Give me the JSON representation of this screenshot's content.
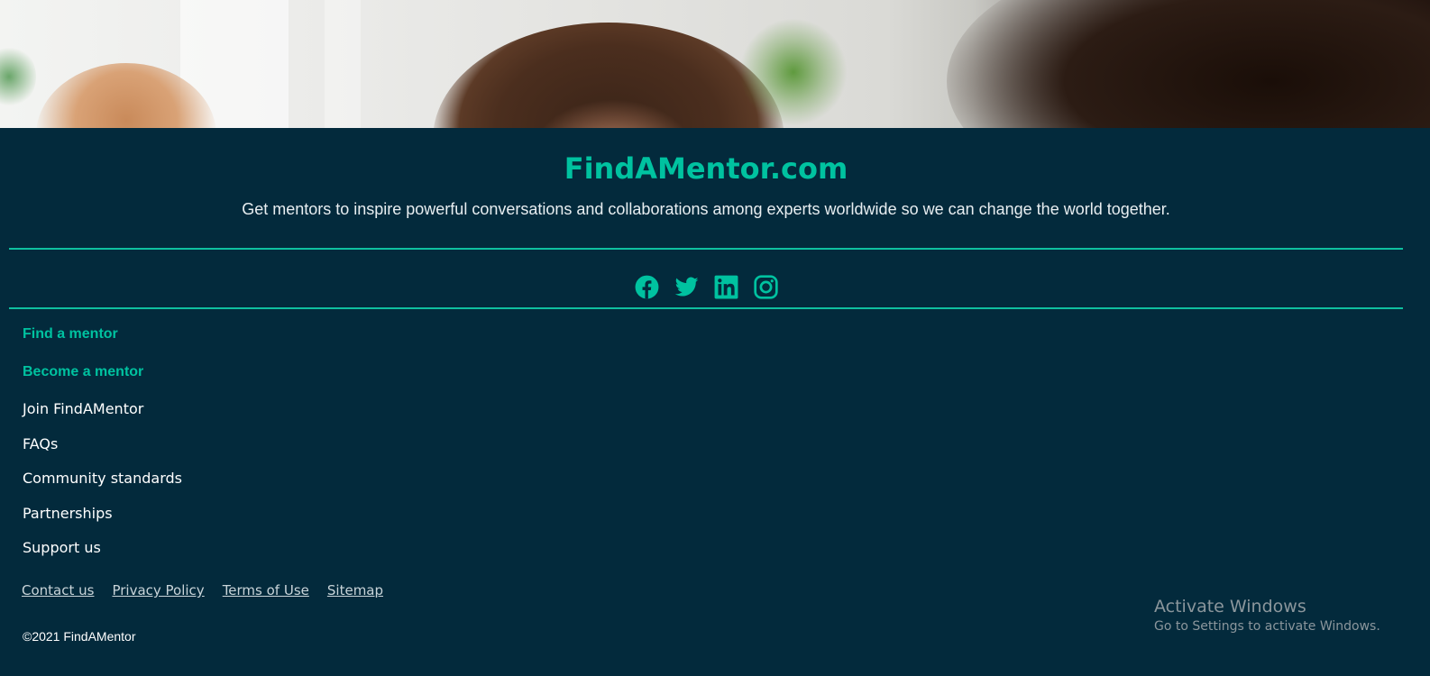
{
  "hero": {
    "image": "photo-people-collaborating"
  },
  "footer": {
    "brand": "FindAMentor.com",
    "tagline": "Get mentors to inspire powerful conversations and collaborations among experts worldwide so we can change the world together.",
    "accent_color": "#00c2a0",
    "background_color": "#032a3c",
    "social": [
      {
        "icon": "facebook-icon"
      },
      {
        "icon": "twitter-icon"
      },
      {
        "icon": "linkedin-icon"
      },
      {
        "icon": "instagram-icon"
      }
    ],
    "nav": {
      "find_mentor": "Find a mentor",
      "become_mentor": "Become a mentor",
      "join": "Join FindAMentor",
      "faqs": "FAQs",
      "community": "Community standards",
      "partnerships": "Partnerships",
      "support": "Support us"
    },
    "legal": {
      "contact": "Contact us",
      "privacy": "Privacy Policy",
      "terms": "Terms of Use",
      "sitemap": "Sitemap"
    },
    "copyright": "©2021 FindAMentor"
  },
  "os_overlay": {
    "title": "Activate Windows",
    "subtitle": "Go to Settings to activate Windows."
  }
}
